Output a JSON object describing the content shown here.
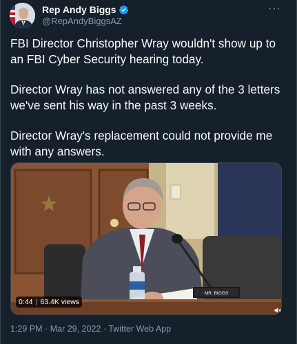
{
  "author": {
    "display_name": "Rep Andy Biggs",
    "handle": "@RepAndyBiggsAZ",
    "verified_icon": "verified-badge-icon"
  },
  "more_icon": "more-options-icon",
  "tweet": {
    "paragraphs": [
      "FBI Director Christopher Wray wouldn't show up to an FBI Cyber Security hearing today.",
      "Director Wray has not answered any of the 3 letters we've sent his way in the past 3 weeks.",
      "Director Wray's replacement could not provide me with any answers."
    ]
  },
  "video": {
    "duration": "0:44",
    "views": "63.4K views",
    "nameplate": "MR. BIGGS",
    "speaker_icon": "mute-speaker-icon"
  },
  "meta": {
    "time": "1:29 PM",
    "date": "Mar 29, 2022",
    "separator": "·",
    "source": "Twitter Web App"
  },
  "colors": {
    "background": "#15202b",
    "text": "#f7f9f9",
    "secondary": "#8b98a5",
    "verified": "#1d9bf0"
  }
}
